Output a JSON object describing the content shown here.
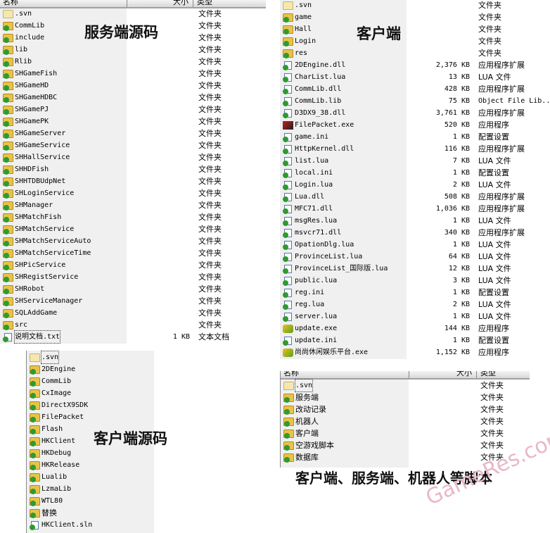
{
  "columns": {
    "name": "名称",
    "size": "大小",
    "type": "类型"
  },
  "labels": {
    "server_source": "服务端源码",
    "client": "客户端",
    "client_source": "客户端源码",
    "scripts": "客户端、服务端、机器人等脚本"
  },
  "watermark": "GameRes.com",
  "server_source": {
    "rows": [
      {
        "name": ".svn",
        "size": "",
        "type": "文件夹",
        "icon": "folder-plain"
      },
      {
        "name": "CommLib",
        "size": "",
        "type": "文件夹",
        "icon": "folder"
      },
      {
        "name": "include",
        "size": "",
        "type": "文件夹",
        "icon": "folder"
      },
      {
        "name": "lib",
        "size": "",
        "type": "文件夹",
        "icon": "folder"
      },
      {
        "name": "Rlib",
        "size": "",
        "type": "文件夹",
        "icon": "folder"
      },
      {
        "name": "SHGameFish",
        "size": "",
        "type": "文件夹",
        "icon": "folder"
      },
      {
        "name": "SHGameHD",
        "size": "",
        "type": "文件夹",
        "icon": "folder"
      },
      {
        "name": "SHGameHDBC",
        "size": "",
        "type": "文件夹",
        "icon": "folder"
      },
      {
        "name": "SHGamePJ",
        "size": "",
        "type": "文件夹",
        "icon": "folder"
      },
      {
        "name": "SHGamePK",
        "size": "",
        "type": "文件夹",
        "icon": "folder"
      },
      {
        "name": "SHGameServer",
        "size": "",
        "type": "文件夹",
        "icon": "folder"
      },
      {
        "name": "SHGameService",
        "size": "",
        "type": "文件夹",
        "icon": "folder"
      },
      {
        "name": "SHHallService",
        "size": "",
        "type": "文件夹",
        "icon": "folder"
      },
      {
        "name": "SHHDFish",
        "size": "",
        "type": "文件夹",
        "icon": "folder"
      },
      {
        "name": "SHHTDBUdpNet",
        "size": "",
        "type": "文件夹",
        "icon": "folder"
      },
      {
        "name": "SHLoginService",
        "size": "",
        "type": "文件夹",
        "icon": "folder"
      },
      {
        "name": "SHManager",
        "size": "",
        "type": "文件夹",
        "icon": "folder"
      },
      {
        "name": "SHMatchFish",
        "size": "",
        "type": "文件夹",
        "icon": "folder"
      },
      {
        "name": "SHMatchService",
        "size": "",
        "type": "文件夹",
        "icon": "folder"
      },
      {
        "name": "SHMatchServiceAuto",
        "size": "",
        "type": "文件夹",
        "icon": "folder"
      },
      {
        "name": "SHMatchServiceTime",
        "size": "",
        "type": "文件夹",
        "icon": "folder"
      },
      {
        "name": "SHPicService",
        "size": "",
        "type": "文件夹",
        "icon": "folder"
      },
      {
        "name": "SHRegistService",
        "size": "",
        "type": "文件夹",
        "icon": "folder"
      },
      {
        "name": "SHRobot",
        "size": "",
        "type": "文件夹",
        "icon": "folder"
      },
      {
        "name": "SHServiceManager",
        "size": "",
        "type": "文件夹",
        "icon": "folder"
      },
      {
        "name": "SQLAddGame",
        "size": "",
        "type": "文件夹",
        "icon": "folder"
      },
      {
        "name": "src",
        "size": "",
        "type": "文件夹",
        "icon": "folder"
      },
      {
        "name": "说明文档.txt",
        "size": "1 KB",
        "type": "文本文档",
        "icon": "text-file"
      }
    ]
  },
  "client": {
    "rows": [
      {
        "name": ".svn",
        "size": "",
        "type": "文件夹",
        "icon": "folder-plain"
      },
      {
        "name": "game",
        "size": "",
        "type": "文件夹",
        "icon": "folder"
      },
      {
        "name": "Hall",
        "size": "",
        "type": "文件夹",
        "icon": "folder"
      },
      {
        "name": "Login",
        "size": "",
        "type": "文件夹",
        "icon": "folder"
      },
      {
        "name": "res",
        "size": "",
        "type": "文件夹",
        "icon": "folder"
      },
      {
        "name": "2DEngine.dll",
        "size": "2,376 KB",
        "type": "应用程序扩展",
        "icon": "dll-file"
      },
      {
        "name": "CharList.lua",
        "size": "13 KB",
        "type": "LUA 文件",
        "icon": "lua-file"
      },
      {
        "name": "CommLib.dll",
        "size": "428 KB",
        "type": "应用程序扩展",
        "icon": "dll-file"
      },
      {
        "name": "CommLib.lib",
        "size": "75 KB",
        "type": "Object File Lib...",
        "icon": "lib-file"
      },
      {
        "name": "D3DX9_38.dll",
        "size": "3,761 KB",
        "type": "应用程序扩展",
        "icon": "dll-file"
      },
      {
        "name": "FilePacket.exe",
        "size": "520 KB",
        "type": "应用程序",
        "icon": "exe-file"
      },
      {
        "name": "game.ini",
        "size": "1 KB",
        "type": "配置设置",
        "icon": "ini-file"
      },
      {
        "name": "HttpKernel.dll",
        "size": "116 KB",
        "type": "应用程序扩展",
        "icon": "dll-file"
      },
      {
        "name": "list.lua",
        "size": "7 KB",
        "type": "LUA 文件",
        "icon": "lua-file"
      },
      {
        "name": "local.ini",
        "size": "1 KB",
        "type": "配置设置",
        "icon": "ini-file"
      },
      {
        "name": "Login.lua",
        "size": "2 KB",
        "type": "LUA 文件",
        "icon": "lua-file"
      },
      {
        "name": "Lua.dll",
        "size": "508 KB",
        "type": "应用程序扩展",
        "icon": "dll-file"
      },
      {
        "name": "MFC71.dll",
        "size": "1,036 KB",
        "type": "应用程序扩展",
        "icon": "dll-file"
      },
      {
        "name": "msgRes.lua",
        "size": "1 KB",
        "type": "LUA 文件",
        "icon": "lua-file"
      },
      {
        "name": "msvcr71.dll",
        "size": "340 KB",
        "type": "应用程序扩展",
        "icon": "dll-file"
      },
      {
        "name": "OpationDlg.lua",
        "size": "1 KB",
        "type": "LUA 文件",
        "icon": "lua-file"
      },
      {
        "name": "ProvinceList.lua",
        "size": "64 KB",
        "type": "LUA 文件",
        "icon": "lua-file"
      },
      {
        "name": "ProvinceList_国际版.lua",
        "size": "12 KB",
        "type": "LUA 文件",
        "icon": "lua-file"
      },
      {
        "name": "public.lua",
        "size": "3 KB",
        "type": "LUA 文件",
        "icon": "lua-file"
      },
      {
        "name": "reg.ini",
        "size": "1 KB",
        "type": "配置设置",
        "icon": "ini-file"
      },
      {
        "name": "reg.lua",
        "size": "2 KB",
        "type": "LUA 文件",
        "icon": "lua-file"
      },
      {
        "name": "server.lua",
        "size": "1 KB",
        "type": "LUA 文件",
        "icon": "lua-file"
      },
      {
        "name": "update.exe",
        "size": "144 KB",
        "type": "应用程序",
        "icon": "exe-app-icon"
      },
      {
        "name": "update.ini",
        "size": "1 KB",
        "type": "配置设置",
        "icon": "ini-file"
      },
      {
        "name": "尚尚休闲娱乐平台.exe",
        "size": "1,152 KB",
        "type": "应用程序",
        "icon": "exe-app-icon"
      }
    ]
  },
  "client_source": {
    "rows": [
      {
        "name": ".svn",
        "icon": "folder-plain"
      },
      {
        "name": "2DEngine",
        "icon": "folder"
      },
      {
        "name": "CommLib",
        "icon": "folder"
      },
      {
        "name": "CxImage",
        "icon": "folder"
      },
      {
        "name": "DirectX9SDK",
        "icon": "folder"
      },
      {
        "name": "FilePacket",
        "icon": "folder"
      },
      {
        "name": "Flash",
        "icon": "folder"
      },
      {
        "name": "HKClient",
        "icon": "folder"
      },
      {
        "name": "HKDebug",
        "icon": "folder"
      },
      {
        "name": "HKRelease",
        "icon": "folder"
      },
      {
        "name": "Lualib",
        "icon": "folder"
      },
      {
        "name": "LzmaLib",
        "icon": "folder"
      },
      {
        "name": "WTL80",
        "icon": "folder"
      },
      {
        "name": "替换",
        "icon": "folder"
      },
      {
        "name": "HKClient.sln",
        "icon": "sln-file"
      }
    ]
  },
  "scripts": {
    "rows": [
      {
        "name": ".svn",
        "size": "",
        "type": "文件夹",
        "icon": "folder-plain"
      },
      {
        "name": "服务端",
        "size": "",
        "type": "文件夹",
        "icon": "folder"
      },
      {
        "name": "改动记录",
        "size": "",
        "type": "文件夹",
        "icon": "folder"
      },
      {
        "name": "机器人",
        "size": "",
        "type": "文件夹",
        "icon": "folder"
      },
      {
        "name": "客户端",
        "size": "",
        "type": "文件夹",
        "icon": "folder"
      },
      {
        "name": "空游戏脚本",
        "size": "",
        "type": "文件夹",
        "icon": "folder"
      },
      {
        "name": "数据库",
        "size": "",
        "type": "文件夹",
        "icon": "folder"
      }
    ]
  }
}
